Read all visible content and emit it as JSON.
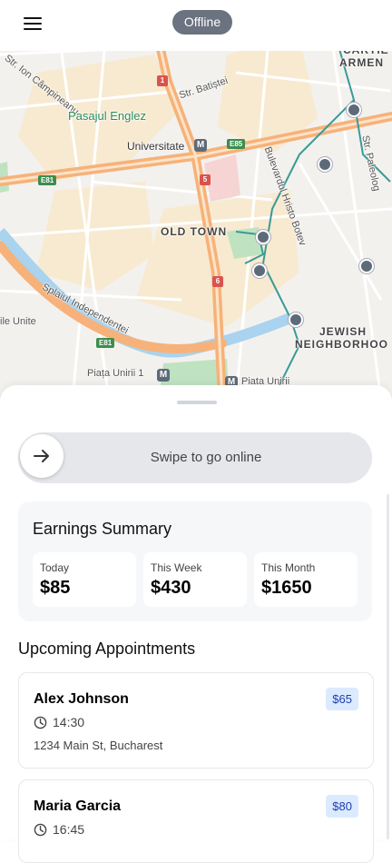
{
  "header": {
    "status": "Offline"
  },
  "map": {
    "labels": {
      "campineanu": "Str. Ion Câmpineanu",
      "pasajul": "Pasajul Englez",
      "universitate": "Universitate",
      "batistei": "Str. Batiștei",
      "bulevardul": "Bulevardul Hristo Botev",
      "old_town": "OLD TOWN",
      "splaiul": "Splaiul Independenței",
      "unite": "ile Unite",
      "jewish1": "JEWISH",
      "jewish2": "NEIGHBORHOO",
      "piata_unirii1": "Piața Unirii 1",
      "piata_unirii": "Piata Unirii",
      "cartier1": "CARTIE",
      "cartier2": "ARMEN",
      "paleolog": "Str. Paleolog",
      "st": "St"
    },
    "shields": {
      "e81_a": "E81",
      "e81_b": "E81",
      "e85": "E85",
      "r1": "1",
      "r5": "5",
      "r6": "6"
    },
    "metro_icon": "M"
  },
  "swipe": {
    "label": "Swipe to go online",
    "icon": "arrow-right-icon"
  },
  "earnings": {
    "title": "Earnings Summary",
    "cards": [
      {
        "label": "Today",
        "value": "$85"
      },
      {
        "label": "This Week",
        "value": "$430"
      },
      {
        "label": "This Month",
        "value": "$1650"
      }
    ]
  },
  "appointments": {
    "title": "Upcoming Appointments",
    "items": [
      {
        "name": "Alex Johnson",
        "price": "$65",
        "time": "14:30",
        "address": "1234 Main St, Bucharest"
      },
      {
        "name": "Maria Garcia",
        "price": "$80",
        "time": "16:45"
      }
    ]
  },
  "colors": {
    "status_offline": "#6b7280",
    "price_badge_bg": "#dbeafe",
    "price_badge_text": "#1e40af",
    "road_major": "#f6b27a",
    "metro_line": "#3a9a96"
  }
}
